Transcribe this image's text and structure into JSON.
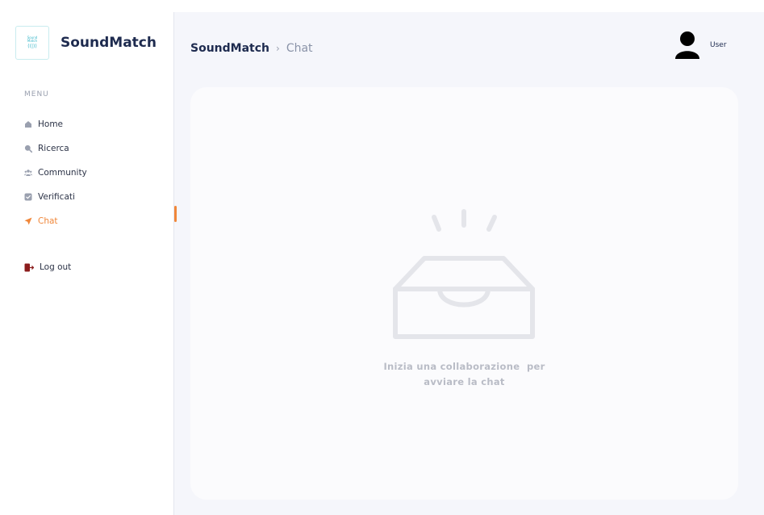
{
  "app": {
    "brand": "SoundMatch",
    "logo_lines": [
      "Sound",
      "Match"
    ]
  },
  "sidebar": {
    "menu_heading": "MENU",
    "items": [
      {
        "label": "Home",
        "icon": "home-icon"
      },
      {
        "label": "Ricerca",
        "icon": "search-icon"
      },
      {
        "label": "Community",
        "icon": "community-icon"
      },
      {
        "label": "Verificati",
        "icon": "verified-icon"
      },
      {
        "label": "Chat",
        "icon": "send-icon",
        "active": true
      }
    ],
    "logout_label": "Log out"
  },
  "header": {
    "breadcrumb_root": "SoundMatch",
    "breadcrumb_separator": "›",
    "breadcrumb_current": "Chat",
    "user_label": "User"
  },
  "main": {
    "empty_state_line1": "Inizia una collaborazione  per",
    "empty_state_line2": "avviare la chat"
  },
  "colors": {
    "accent": "#f0873a",
    "brand_text": "#1e2b4f",
    "background": "#f5f6fb",
    "logout_icon": "#8b1c1c"
  }
}
